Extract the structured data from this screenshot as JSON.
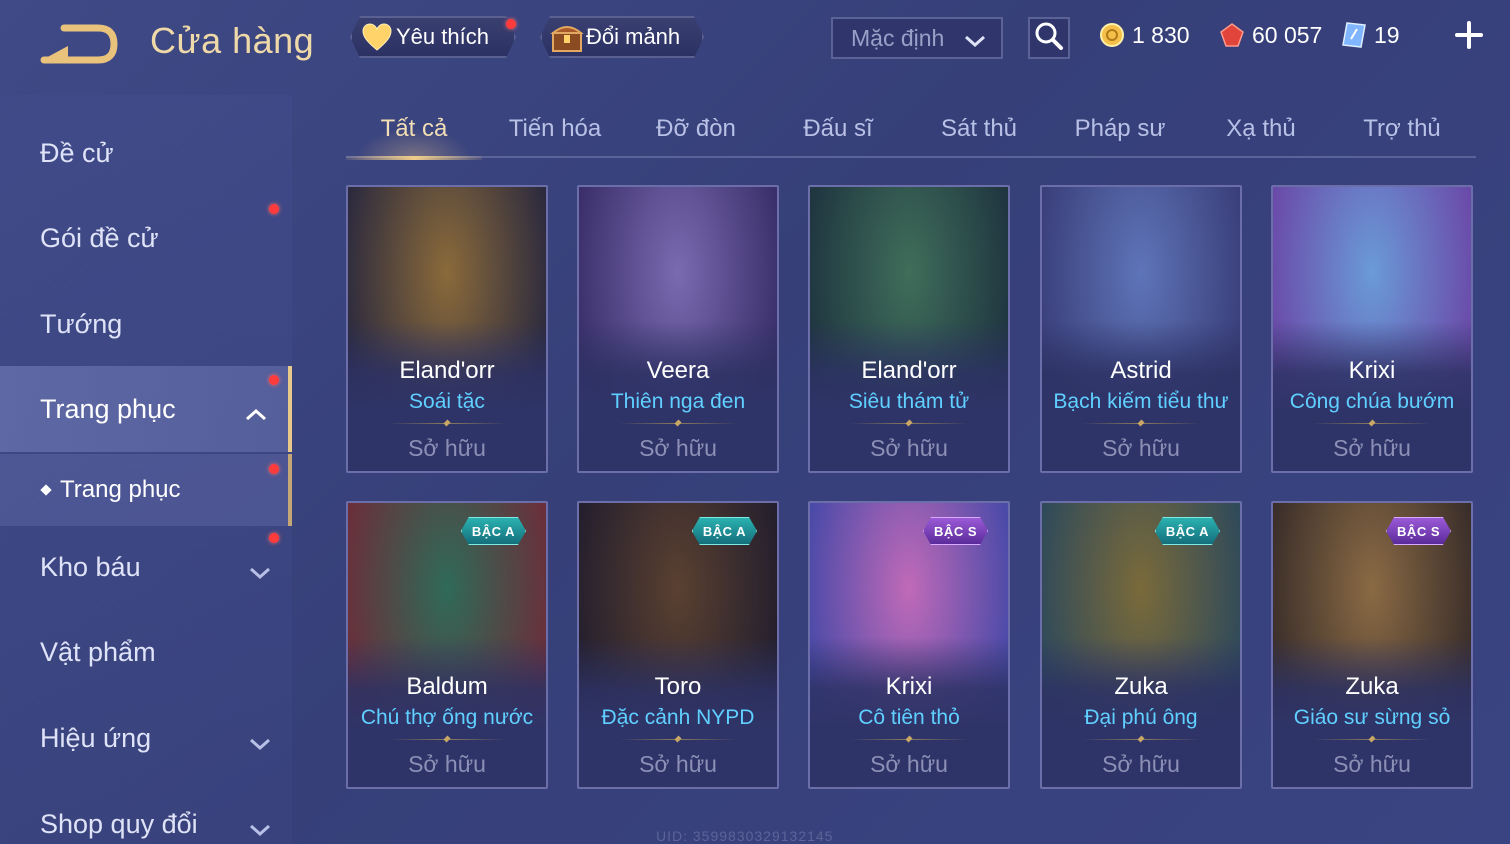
{
  "header": {
    "title": "Cửa hàng",
    "favorites_label": "Yêu thích",
    "exchange_label": "Đổi mảnh",
    "sort_value": "Mặc định",
    "currencies": [
      {
        "name": "gold",
        "value": "1 830"
      },
      {
        "name": "vouchers",
        "value": "60 057"
      },
      {
        "name": "tokens",
        "value": "19"
      }
    ]
  },
  "sidebar": {
    "items": [
      {
        "label": "Đề cử"
      },
      {
        "label": "Gói đề cử"
      },
      {
        "label": "Tướng"
      },
      {
        "label": "Trang phục"
      },
      {
        "label": "Trang phục"
      },
      {
        "label": "Kho báu"
      },
      {
        "label": "Vật phẩm"
      },
      {
        "label": "Hiệu ứng"
      },
      {
        "label": "Shop quy đổi"
      }
    ]
  },
  "tabs": [
    {
      "label": "Tất cả"
    },
    {
      "label": "Tiến hóa"
    },
    {
      "label": "Đỡ đòn"
    },
    {
      "label": "Đấu sĩ"
    },
    {
      "label": "Sát thủ"
    },
    {
      "label": "Pháp sư"
    },
    {
      "label": "Xạ thủ"
    },
    {
      "label": "Trợ thủ"
    }
  ],
  "cards": [
    {
      "hero": "Eland'orr",
      "skin": "Soái tặc",
      "status": "Sở hữu",
      "tier": "",
      "colors": [
        "#8a6a3a",
        "#2c2a3e"
      ]
    },
    {
      "hero": "Veera",
      "skin": "Thiên nga đen",
      "status": "Sở hữu",
      "tier": "",
      "colors": [
        "#7a6ab0",
        "#3a2f6a"
      ]
    },
    {
      "hero": "Eland'orr",
      "skin": "Siêu thám tử",
      "status": "Sở hữu",
      "tier": "",
      "colors": [
        "#3f6e5a",
        "#1f3540"
      ]
    },
    {
      "hero": "Astrid",
      "skin": "Bạch kiếm tiểu thư",
      "status": "Sở hữu",
      "tier": "",
      "colors": [
        "#5e74b8",
        "#3a3f7a"
      ]
    },
    {
      "hero": "Krixi",
      "skin": "Công chúa bướm",
      "status": "Sở hữu",
      "tier": "",
      "colors": [
        "#6a9ad8",
        "#6a4aa8"
      ]
    },
    {
      "hero": "Baldum",
      "skin": "Chú thợ ống nước",
      "status": "Sở hữu",
      "tier": "BẬC A",
      "colors": [
        "#2f6a58",
        "#6a2f3a"
      ]
    },
    {
      "hero": "Toro",
      "skin": "Đặc cảnh NYPD",
      "status": "Sở hữu",
      "tier": "BẬC A",
      "colors": [
        "#5a4030",
        "#241f2e"
      ]
    },
    {
      "hero": "Krixi",
      "skin": "Cô tiên thỏ",
      "status": "Sở hữu",
      "tier": "BẬC S",
      "colors": [
        "#c06ab8",
        "#4a4aa8"
      ]
    },
    {
      "hero": "Zuka",
      "skin": "Đại phú ông",
      "status": "Sở hữu",
      "tier": "BẬC A",
      "colors": [
        "#7a6a3a",
        "#2f4a5a"
      ]
    },
    {
      "hero": "Zuka",
      "skin": "Giáo sư sừng sỏ",
      "status": "Sở hữu",
      "tier": "BẬC S",
      "colors": [
        "#8a6a44",
        "#3a2e2a"
      ]
    }
  ],
  "watermark": "UID: 3599830329132145",
  "colors": {
    "accent_gold": "#f0cd8b",
    "skin_name": "#5fd0ff",
    "notification": "#ff3b3b"
  }
}
